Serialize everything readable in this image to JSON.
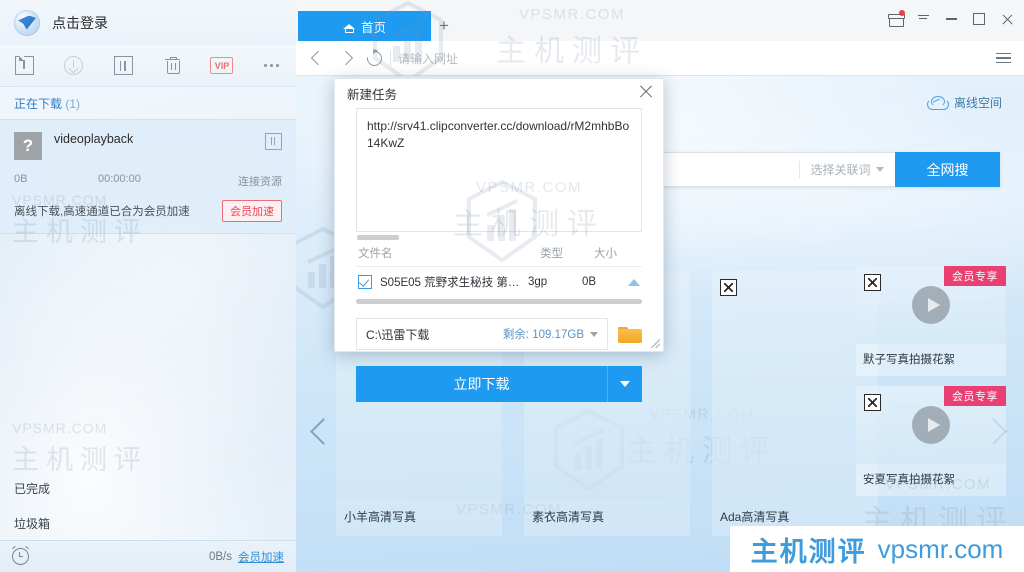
{
  "downloader": {
    "account_label": "点击登录",
    "toolbar": [
      {
        "name": "new-task-icon",
        "label": "新建任务"
      },
      {
        "name": "download-icon",
        "label": "开始下载"
      },
      {
        "name": "pause-icon",
        "label": "暂停"
      },
      {
        "name": "delete-icon",
        "label": "删除"
      },
      {
        "name": "vip-icon",
        "label": "VIP"
      },
      {
        "name": "more-icon",
        "label": "更多"
      }
    ],
    "section_title": "正在下载",
    "section_count": "(1)",
    "task": {
      "thumb_glyph": "?",
      "name": "videoplayback",
      "size": "0B",
      "time": "00:00:00",
      "status": "连接资源",
      "note": "离线下载,高速通道已合为会员加速",
      "accel_label": "会员加速"
    },
    "links": [
      "已完成",
      "垃圾箱"
    ],
    "status_speed": "0B/s",
    "status_accel": "会员加速"
  },
  "browser": {
    "tab_label": "首页",
    "new_tab": "+",
    "url_placeholder": "请输入网址",
    "window_buttons": [
      "gift-icon",
      "download-tray-icon",
      "minimize",
      "maximize",
      "close"
    ]
  },
  "page": {
    "offline_space": "离线空间",
    "search": {
      "value": "",
      "placeholder": "",
      "keyword_label": "选择关联词",
      "button_label": "全网搜"
    },
    "cards": [
      {
        "title": "小羊高清写真",
        "badge": ""
      },
      {
        "title": "素衣高清写真",
        "badge": ""
      },
      {
        "title": "Ada高清写真",
        "badge": ""
      }
    ],
    "side_cards": [
      {
        "title": "默子写真拍摄花絮",
        "badge": "会员专享"
      },
      {
        "title": "安夏写真拍摄花絮",
        "badge": "会员专享"
      }
    ],
    "watermark_en": "VPSMR.COM",
    "watermark_cn": "主机测评",
    "bottom_watermark_cn": "主机测评",
    "bottom_watermark_en": "vpsmr.com"
  },
  "dialog": {
    "title": "新建任务",
    "url": "http://srv41.clipconverter.cc/download/rM2mhbBo14KwZ",
    "columns": {
      "name": "文件名",
      "type": "类型",
      "size": "大小"
    },
    "files": [
      {
        "name": "S05E05 荒野求生秘技 第五季...",
        "type": "3gp",
        "size": "0B",
        "checked": true
      }
    ],
    "save_path": "C:\\迅雷下载",
    "free_space": "剩余: 109.17GB",
    "download_button": "立即下载"
  },
  "colors": {
    "accent": "#1e9af0",
    "vip_pink": "#ea3f72",
    "vip_red": "#ef4458",
    "link_blue": "#2e7fc4"
  }
}
